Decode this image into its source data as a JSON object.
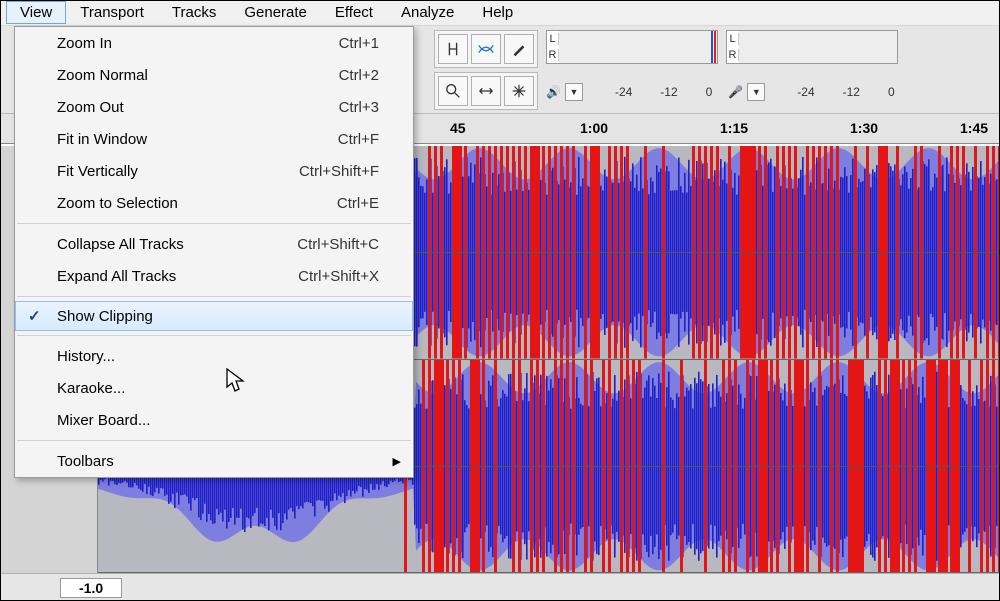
{
  "menubar": {
    "items": [
      "View",
      "Transport",
      "Tracks",
      "Generate",
      "Effect",
      "Analyze",
      "Help"
    ],
    "open_index": 0
  },
  "dropdown": {
    "groups": [
      [
        {
          "label": "Zoom In",
          "shortcut": "Ctrl+1"
        },
        {
          "label": "Zoom Normal",
          "shortcut": "Ctrl+2"
        },
        {
          "label": "Zoom Out",
          "shortcut": "Ctrl+3"
        },
        {
          "label": "Fit in Window",
          "shortcut": "Ctrl+F"
        },
        {
          "label": "Fit Vertically",
          "shortcut": "Ctrl+Shift+F"
        },
        {
          "label": "Zoom to Selection",
          "shortcut": "Ctrl+E"
        }
      ],
      [
        {
          "label": "Collapse All Tracks",
          "shortcut": "Ctrl+Shift+C"
        },
        {
          "label": "Expand All Tracks",
          "shortcut": "Ctrl+Shift+X"
        }
      ],
      [
        {
          "label": "Show Clipping",
          "checked": true,
          "hovered": true
        }
      ],
      [
        {
          "label": "History..."
        },
        {
          "label": "Karaoke..."
        },
        {
          "label": "Mixer Board..."
        }
      ],
      [
        {
          "label": "Toolbars",
          "submenu": true
        }
      ]
    ]
  },
  "meters": {
    "left_label": "L",
    "right_label": "R",
    "scale": [
      "-24",
      "-12",
      "0"
    ]
  },
  "timeline": {
    "labels": [
      {
        "text": "45",
        "pos": 450
      },
      {
        "text": "1:00",
        "pos": 580
      },
      {
        "text": "1:15",
        "pos": 720
      },
      {
        "text": "1:30",
        "pos": 850
      },
      {
        "text": "1:45",
        "pos": 970
      }
    ]
  },
  "bottom": {
    "value": "-1.0"
  },
  "icons": {
    "speaker": "🔊",
    "mic": "🎤"
  }
}
